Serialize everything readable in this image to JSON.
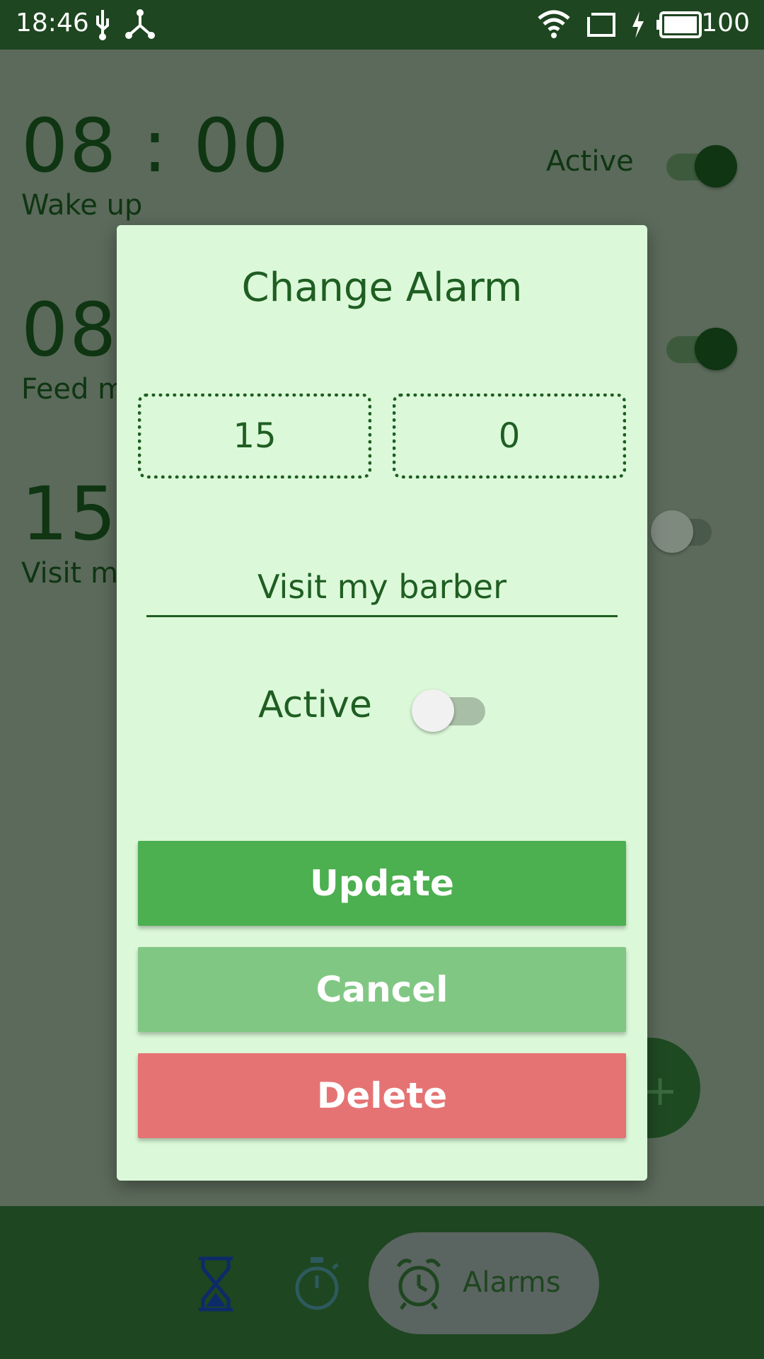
{
  "status_bar": {
    "time": "18:46",
    "battery": "100",
    "icons": [
      "usb-icon",
      "network-share-icon",
      "wifi-icon",
      "cast-icon",
      "charging-icon",
      "battery-icon"
    ]
  },
  "background_alarms": [
    {
      "time": "08 : 00",
      "label": "Wake up",
      "active_label": "Active",
      "active": true
    },
    {
      "time": "08",
      "label": "Feed m",
      "active": true
    },
    {
      "time": "15",
      "label": "Visit m",
      "active": false
    }
  ],
  "fab": {
    "icon": "plus-icon"
  },
  "bottom_nav": {
    "items": [
      {
        "icon": "hourglass-icon"
      },
      {
        "icon": "stopwatch-icon"
      },
      {
        "icon": "alarm-clock-icon",
        "label": "Alarms",
        "selected": true
      }
    ]
  },
  "dialog": {
    "title": "Change Alarm",
    "hour": "15",
    "minute": "0",
    "name_value": "Visit my barber",
    "active_label": "Active",
    "active": false,
    "buttons": {
      "update": "Update",
      "cancel": "Cancel",
      "delete": "Delete"
    }
  },
  "colors": {
    "status_bar": "#1e4620",
    "dialog_bg": "#dbf9d9",
    "primary_text": "#1f5e22",
    "update_button": "#4caf50",
    "cancel_button": "#81c784",
    "delete_button": "#e57373"
  }
}
